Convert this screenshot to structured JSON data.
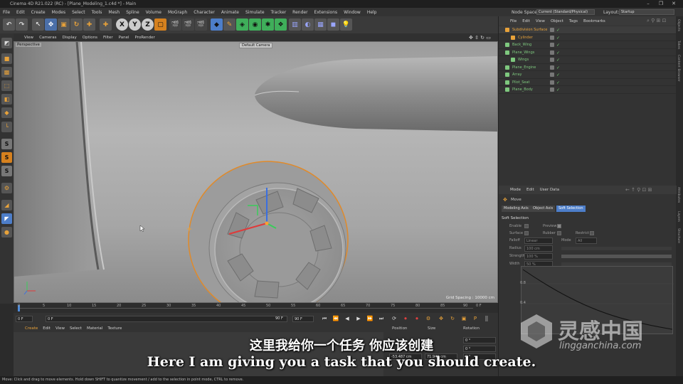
{
  "window": {
    "title": "Cinema 4D R21.022 (RC) - [Plane_Modeling_1.c4d *] - Main",
    "controls": [
      "–",
      "❐",
      "✕"
    ]
  },
  "menu": [
    "File",
    "Edit",
    "Create",
    "Modes",
    "Select",
    "Tools",
    "Mesh",
    "Spline",
    "Volume",
    "MoGraph",
    "Character",
    "Animate",
    "Simulate",
    "Tracker",
    "Render",
    "Extensions",
    "Window",
    "Help"
  ],
  "nodespace": {
    "label": "Node Space:",
    "value": "Current (Standard/Physical)",
    "layout_label": "Layout:",
    "layout_value": "Startup"
  },
  "toolbar": {
    "axis_x": "X",
    "axis_y": "Y",
    "axis_z": "Z"
  },
  "viewport": {
    "menu": [
      "View",
      "Cameras",
      "Display",
      "Options",
      "Filter",
      "Panel",
      "ProRender"
    ],
    "label": "Perspective",
    "camera": "Default Camera",
    "grid": "Grid Spacing : 10000 cm"
  },
  "timeline": {
    "ticks": [
      "0",
      "5",
      "10",
      "15",
      "20",
      "25",
      "30",
      "35",
      "40",
      "45",
      "50",
      "55",
      "60",
      "65",
      "70",
      "75",
      "80",
      "85",
      "90"
    ],
    "end_label": "0 F"
  },
  "playback": {
    "current": "0 F",
    "start": "0 F",
    "end": "90 F",
    "end2": "90 F"
  },
  "materials": {
    "menu": [
      "Create",
      "Edit",
      "View",
      "Select",
      "Material",
      "Texture"
    ]
  },
  "coordinates": {
    "headers": [
      "Position",
      "Size",
      "Rotation"
    ],
    "x_pos": "-53.487 cm",
    "y_size": "71.941 cm",
    "h_rot": "0 °",
    "p_rot": "0 °",
    "b_rot": "0 °"
  },
  "objects": {
    "menu": [
      "File",
      "Edit",
      "View",
      "Object",
      "Tags",
      "Bookmarks"
    ],
    "items": [
      {
        "name": "Subdivision Surface",
        "color": "#e8a23a",
        "indent": 0
      },
      {
        "name": "Cylinder",
        "color": "#e8a23a",
        "indent": 1
      },
      {
        "name": "Back_Wing",
        "color": "#7ec87e",
        "indent": 0
      },
      {
        "name": "Plane_Wings",
        "color": "#7ec87e",
        "indent": 0
      },
      {
        "name": "Wings",
        "color": "#7ec87e",
        "indent": 1
      },
      {
        "name": "Plane_Engine",
        "color": "#7ec87e",
        "indent": 0
      },
      {
        "name": "Array",
        "color": "#7ec87e",
        "indent": 0
      },
      {
        "name": "Pilot_Seat",
        "color": "#7ec87e",
        "indent": 0
      },
      {
        "name": "Plane_Body",
        "color": "#7ec87e",
        "indent": 0
      }
    ]
  },
  "side_tabs": [
    "Objects",
    "Takes",
    "Content Browser",
    "Attributes",
    "Layers",
    "Structure"
  ],
  "attributes": {
    "menu": [
      "Mode",
      "Edit",
      "User Data"
    ],
    "tool": "Move",
    "tabs": [
      "Modeling Axis",
      "Object Axis",
      "Soft Selection"
    ],
    "section": "Soft Selection",
    "enable": "Enable",
    "preview": "Preview",
    "surface": "Surface",
    "rubber": "Rubber",
    "restrict": "Restrict",
    "falloff": "Falloff",
    "falloff_value": "Linear",
    "mode": "Mode",
    "mode_value": "All",
    "radius": "Radius",
    "radius_value": "100 cm",
    "strength": "Strength",
    "strength_value": "100 %",
    "width": "Width",
    "width_value": "50 %",
    "graph_y1": "0.8",
    "graph_y2": "0.4"
  },
  "status": "Move: Click and drag to move elements. Hold down SHIFT to quantize movement / add to the selection in point mode, CTRL to remove.",
  "subtitles": {
    "zh": "这里我给你一个任务 你应该创建",
    "en": "Here I am giving you a task that you should create."
  },
  "watermark": {
    "brand": "灵感中国",
    "url": "lingganchina.com"
  }
}
